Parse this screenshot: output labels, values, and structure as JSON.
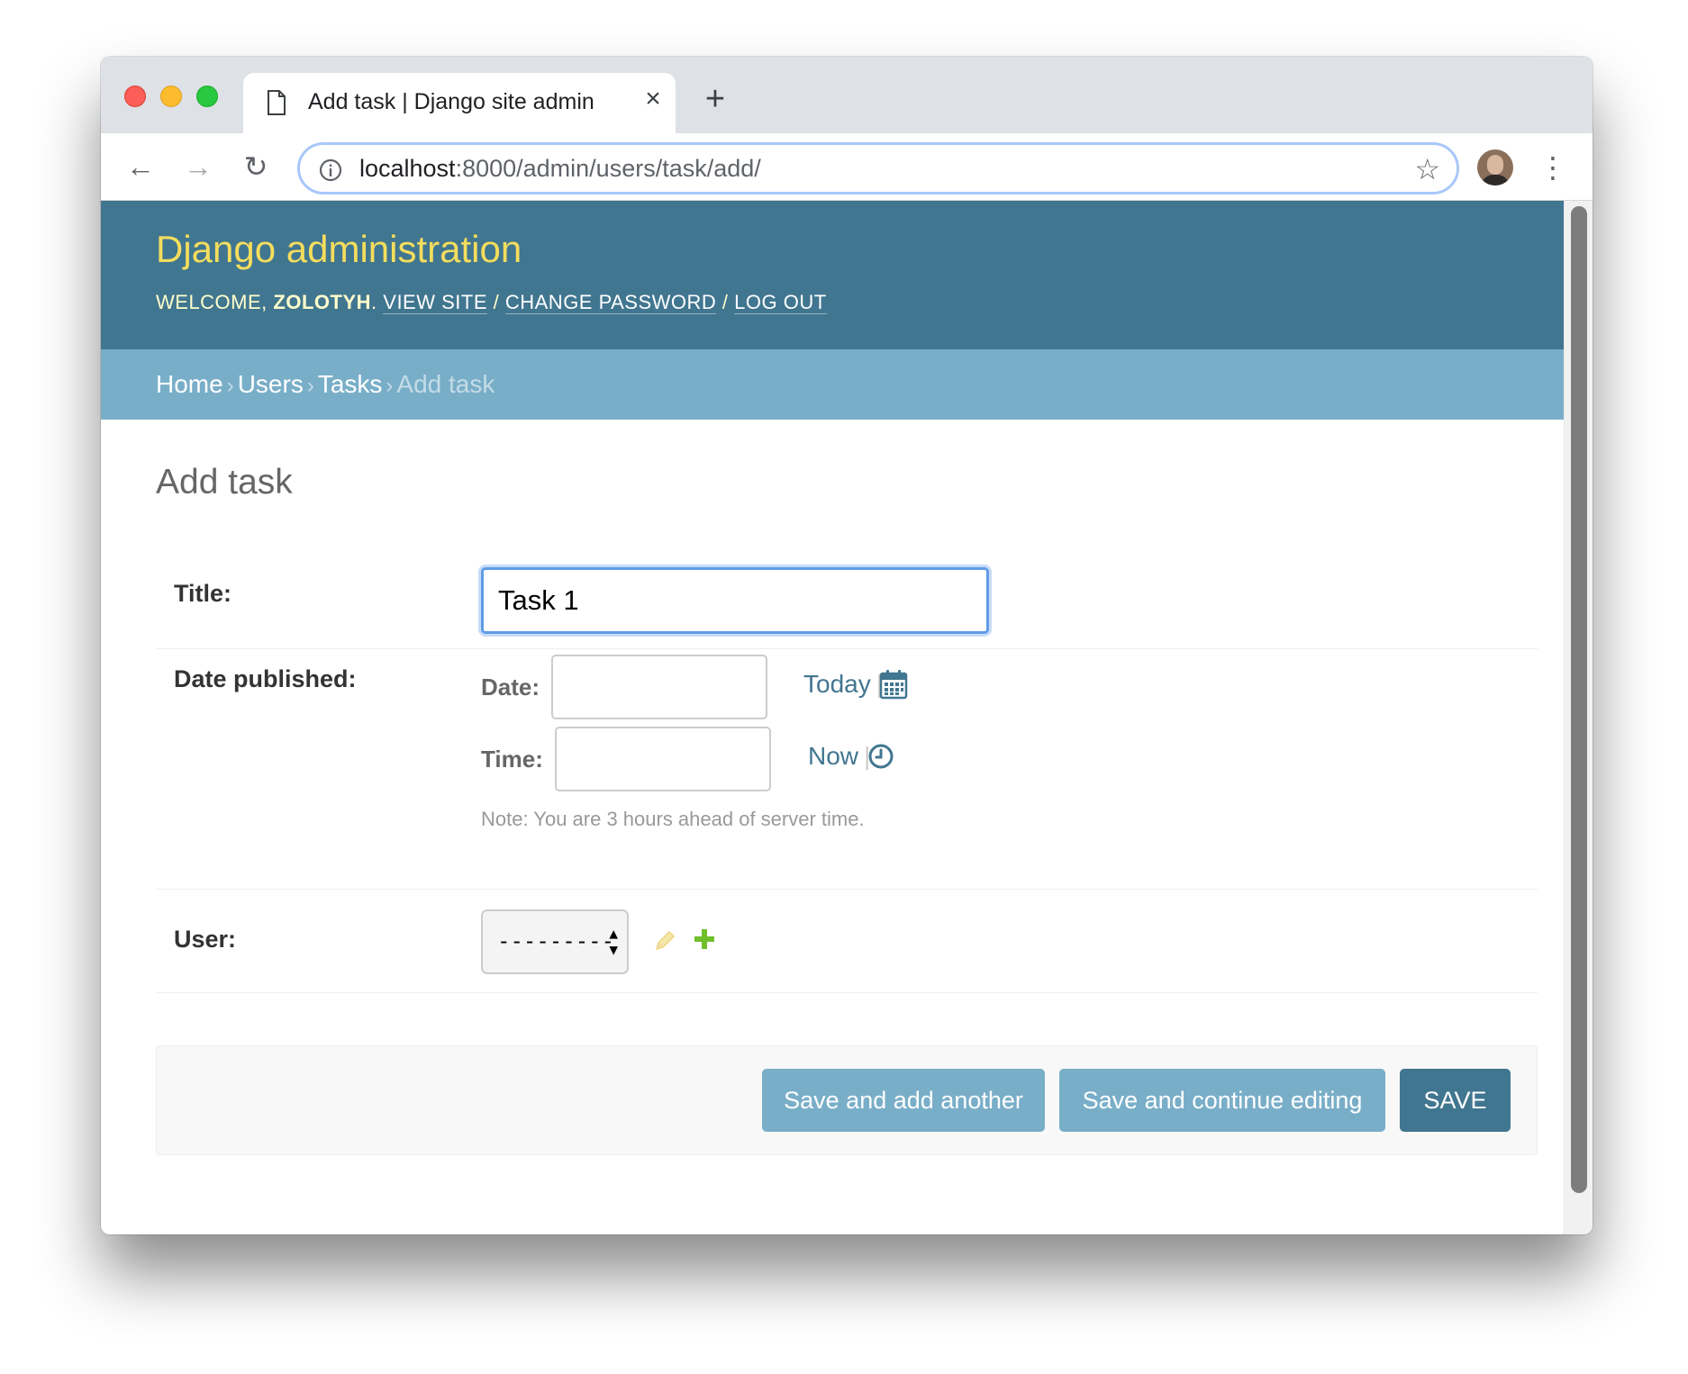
{
  "browser": {
    "tab_title": "Add task | Django site admin",
    "tab_close": "×",
    "new_tab": "+",
    "url_host": "localhost",
    "url_path": ":8000/admin/users/task/add/",
    "back": "←",
    "forward": "→",
    "reload": "↻",
    "star": "☆",
    "menu": "⋮"
  },
  "header": {
    "branding": "Django administration",
    "welcome": "Welcome, ",
    "username": "zolotyh",
    "period": ".",
    "view_site": "View site",
    "change_password": "Change password",
    "log_out": "Log out",
    "sep": " / "
  },
  "breadcrumbs": {
    "home": "Home",
    "users": "Users",
    "tasks": "Tasks",
    "current": "Add task",
    "arrow": "›"
  },
  "page": {
    "title": "Add task"
  },
  "form": {
    "title_label": "Title:",
    "title_value": "Task 1",
    "date_published_label": "Date published:",
    "date_label": "Date:",
    "date_value": "",
    "today_link": "Today",
    "time_label": "Time:",
    "time_value": "",
    "now_link": "Now",
    "pipe": "|",
    "timezone_note": "Note: You are 3 hours ahead of server time.",
    "user_label": "User:",
    "user_selected": "---------"
  },
  "actions": {
    "save_add_another": "Save and add another",
    "save_continue": "Save and continue editing",
    "save": "Save"
  },
  "icons": {
    "page": "page-icon",
    "info": "info-icon",
    "calendar": "calendar-icon",
    "clock": "clock-icon",
    "pencil": "pencil-icon",
    "plus": "plus-icon"
  },
  "colors": {
    "header_bg": "#417690",
    "branding": "#f5dd5d",
    "breadcrumbs_bg": "#79aec8",
    "primary_button": "#417690",
    "secondary_button": "#79aec8",
    "link": "#417690",
    "add_icon": "#70bf2b"
  }
}
